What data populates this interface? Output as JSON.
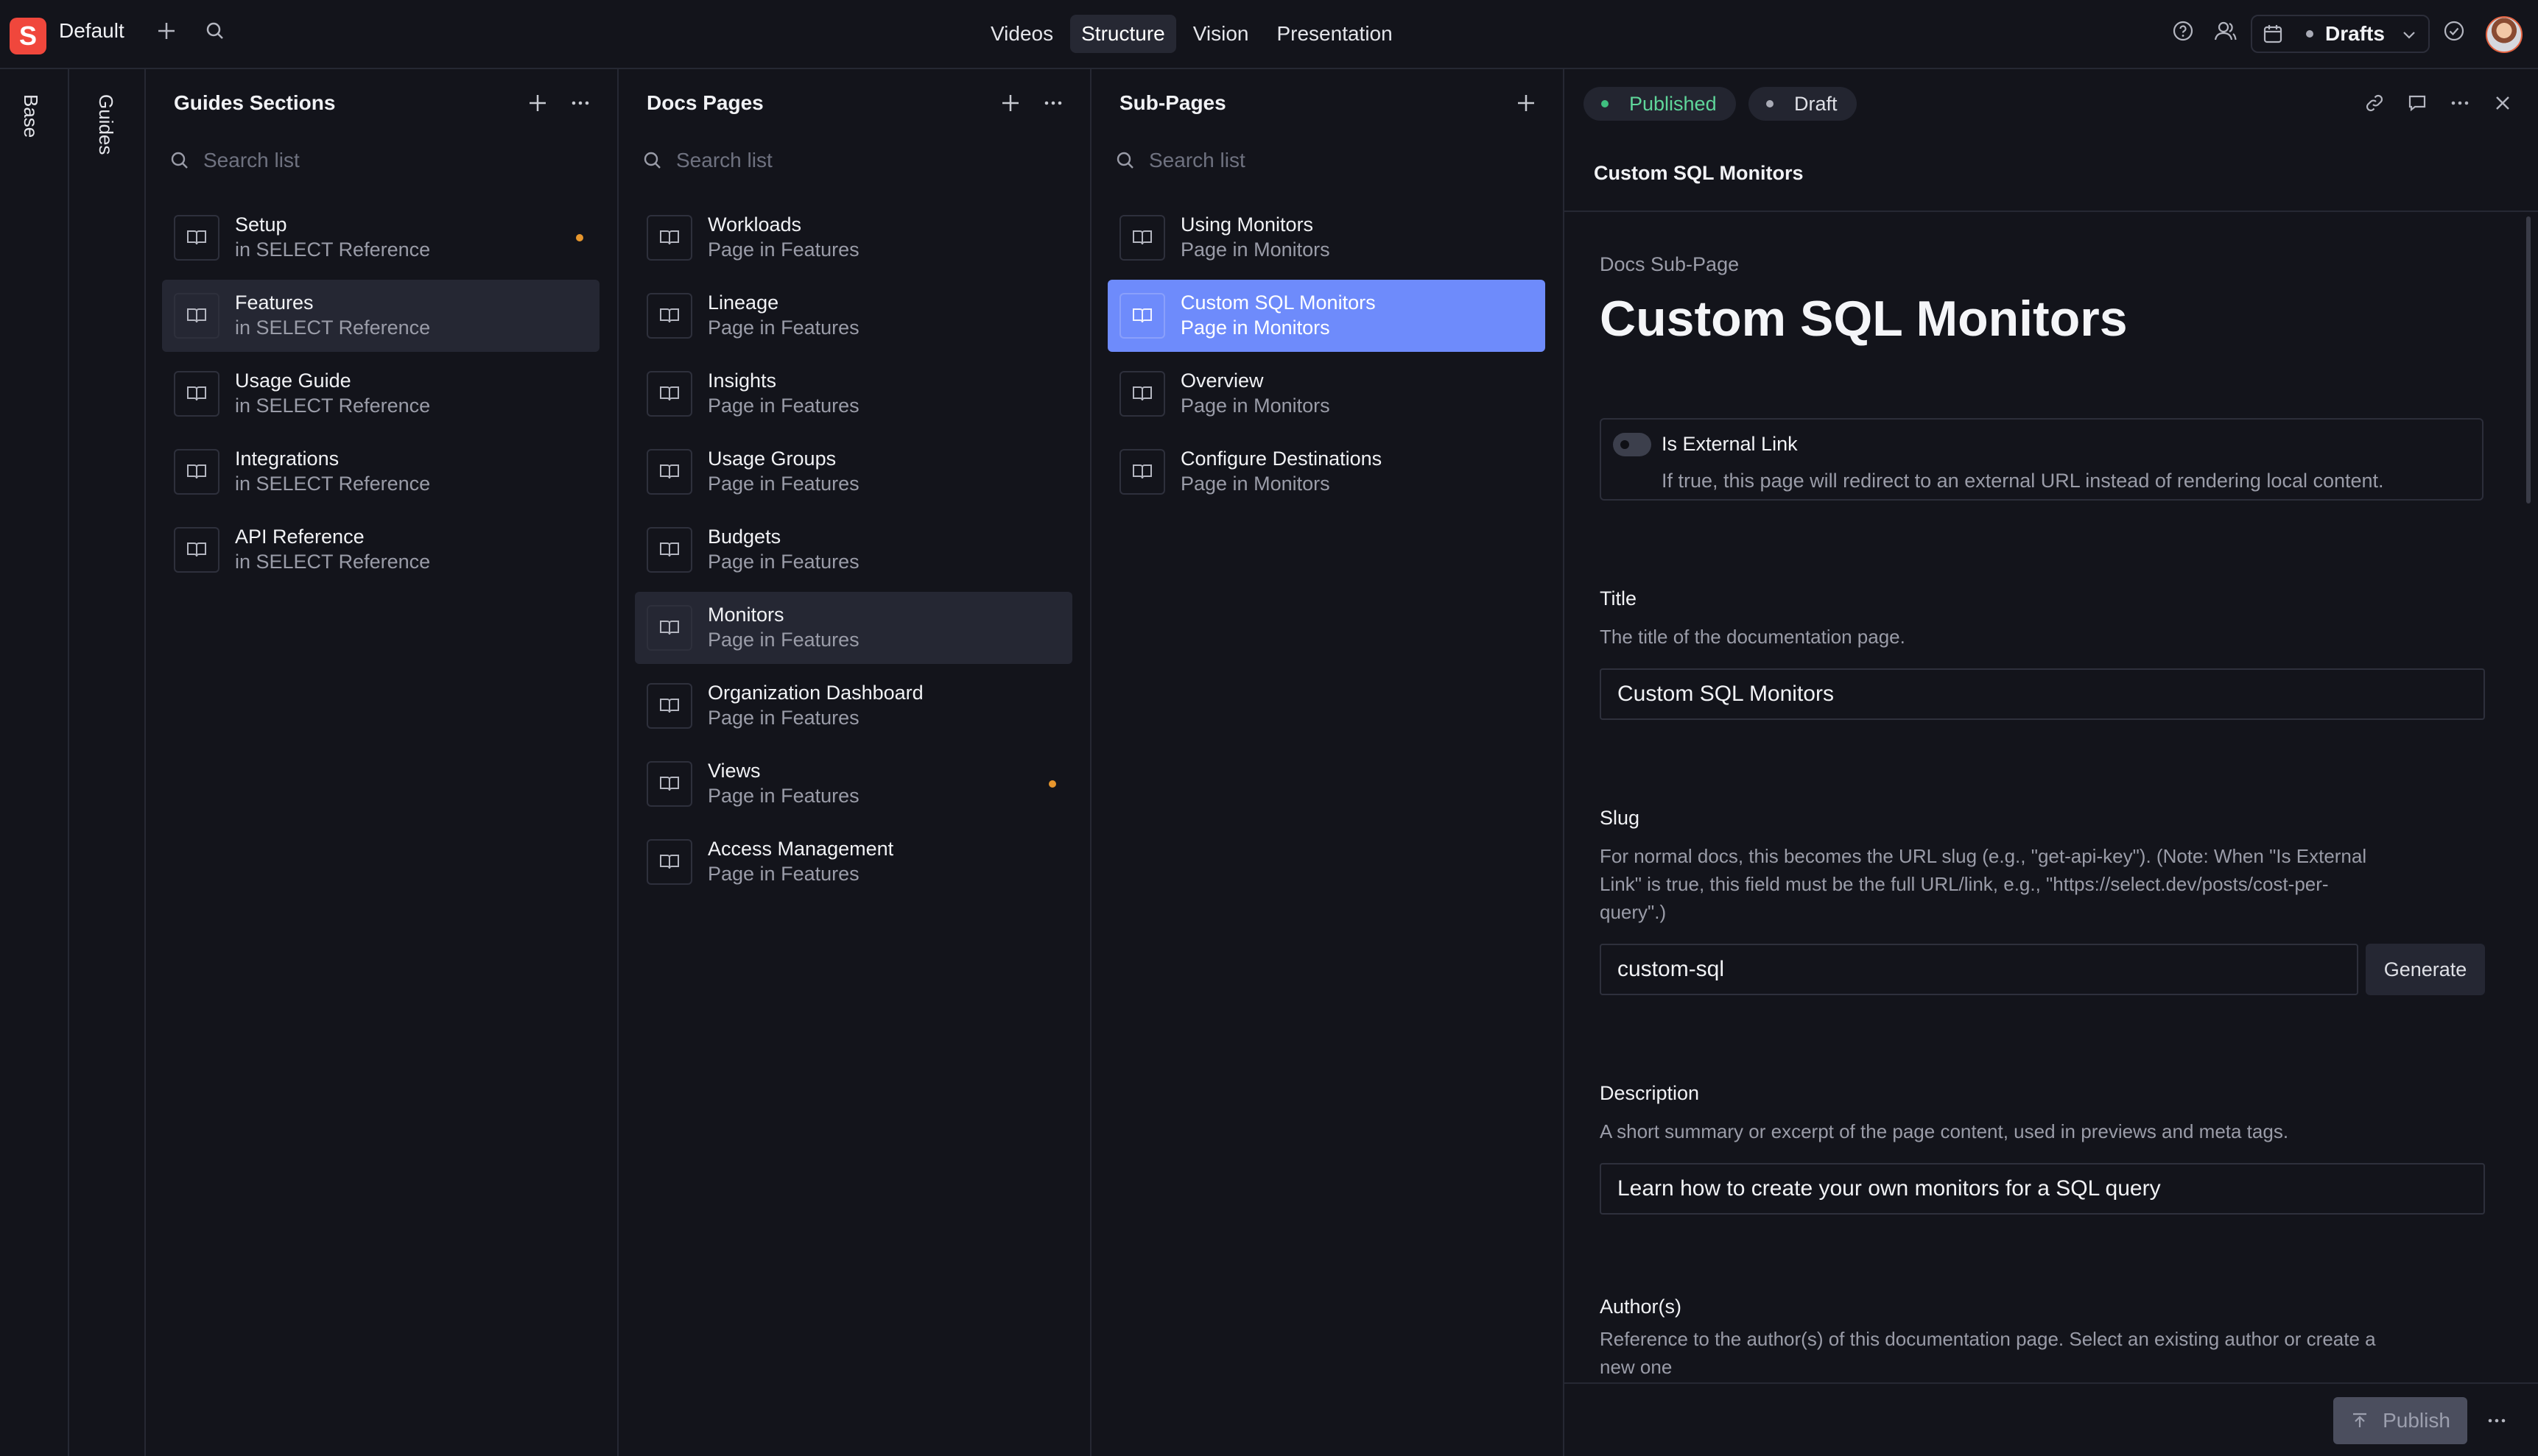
{
  "app": {
    "logo_letter": "S",
    "workspace": "Default",
    "nav_tabs": [
      {
        "label": "Videos",
        "active": false
      },
      {
        "label": "Structure",
        "active": true
      },
      {
        "label": "Vision",
        "active": false
      },
      {
        "label": "Presentation",
        "active": false
      }
    ],
    "drafts_label": "Drafts"
  },
  "rails": {
    "base_label": "Base",
    "guides_label": "Guides"
  },
  "panes": [
    {
      "title": "Guides Sections",
      "search_placeholder": "Search list",
      "items": [
        {
          "title": "Setup",
          "subtitle": "in SELECT Reference",
          "changed": true
        },
        {
          "title": "Features",
          "subtitle": "in SELECT Reference",
          "selected": true
        },
        {
          "title": "Usage Guide",
          "subtitle": "in SELECT Reference"
        },
        {
          "title": "Integrations",
          "subtitle": "in SELECT Reference"
        },
        {
          "title": "API Reference",
          "subtitle": "in SELECT Reference"
        }
      ]
    },
    {
      "title": "Docs Pages",
      "search_placeholder": "Search list",
      "items": [
        {
          "title": "Workloads",
          "subtitle": "Page in Features"
        },
        {
          "title": "Lineage",
          "subtitle": "Page in Features"
        },
        {
          "title": "Insights",
          "subtitle": "Page in Features"
        },
        {
          "title": "Usage Groups",
          "subtitle": "Page in Features"
        },
        {
          "title": "Budgets",
          "subtitle": "Page in Features"
        },
        {
          "title": "Monitors",
          "subtitle": "Page in Features",
          "selected": true
        },
        {
          "title": "Organization Dashboard",
          "subtitle": "Page in Features"
        },
        {
          "title": "Views",
          "subtitle": "Page in Features",
          "changed": true
        },
        {
          "title": "Access Management",
          "subtitle": "Page in Features"
        }
      ]
    },
    {
      "title": "Sub-Pages",
      "search_placeholder": "Search list",
      "items": [
        {
          "title": "Using Monitors",
          "subtitle": "Page in Monitors"
        },
        {
          "title": "Custom SQL Monitors",
          "subtitle": "Page in Monitors",
          "highlighted": true
        },
        {
          "title": "Overview",
          "subtitle": "Page in Monitors"
        },
        {
          "title": "Configure Destinations",
          "subtitle": "Page in Monitors"
        }
      ]
    }
  ],
  "document": {
    "status_published": "Published",
    "status_draft": "Draft",
    "header_title": "Custom SQL Monitors",
    "doc_type": "Docs Sub-Page",
    "title": "Custom SQL Monitors",
    "external_link": {
      "label": "Is External Link",
      "description": "If true, this page will redirect to an external URL instead of rendering local content.",
      "enabled": false
    },
    "fields": {
      "title": {
        "label": "Title",
        "description": "The title of the documentation page.",
        "value": "Custom SQL Monitors"
      },
      "slug": {
        "label": "Slug",
        "description": "For normal docs, this becomes the URL slug (e.g., \"get-api-key\"). (Note: When \"Is External Link\" is true, this field must be the full URL/link, e.g., \"https://select.dev/posts/cost-per-query\".)",
        "value": "custom-sql",
        "generate_label": "Generate"
      },
      "description": {
        "label": "Description",
        "description": "A short summary or excerpt of the page content, used in previews and meta tags.",
        "value": "Learn how to create your own monitors for a SQL query"
      },
      "authors": {
        "label": "Author(s)",
        "description": "Reference to the author(s) of this documentation page. Select an existing author or create a new one"
      }
    },
    "publish_label": "Publish"
  },
  "colors": {
    "accent": "#6e8bfb",
    "published_dot": "#3fbf7f",
    "changed_dot": "#e7962d",
    "brand": "#f0473c"
  }
}
